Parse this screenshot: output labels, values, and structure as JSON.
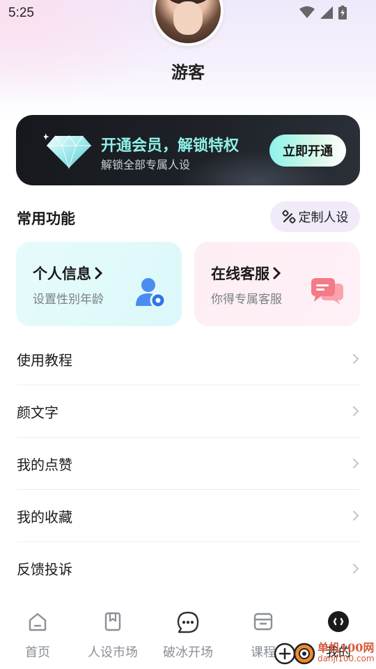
{
  "status_bar": {
    "time": "5:25"
  },
  "profile": {
    "username": "游客"
  },
  "vip": {
    "title": "开通会员，解锁特权",
    "subtitle": "解锁全部专属人设",
    "button_label": "立即开通"
  },
  "features": {
    "section_title": "常用功能",
    "custom_button_label": "定制人设",
    "cards": [
      {
        "title": "个人信息",
        "subtitle": "设置性别年龄",
        "icon": "user-settings-icon"
      },
      {
        "title": "在线客服",
        "subtitle": "你得专属客服",
        "icon": "chat-bubbles-icon"
      }
    ]
  },
  "menu": {
    "items": [
      {
        "label": "使用教程"
      },
      {
        "label": "颜文字"
      },
      {
        "label": "我的点赞"
      },
      {
        "label": "我的收藏"
      },
      {
        "label": "反馈投诉"
      }
    ]
  },
  "tab_bar": {
    "tabs": [
      {
        "label": "首页",
        "icon": "home-icon"
      },
      {
        "label": "人设市场",
        "icon": "bookmark-icon"
      },
      {
        "label": "破冰开场",
        "icon": "chat-dots-icon"
      },
      {
        "label": "课程",
        "icon": "archive-box-icon"
      },
      {
        "label": "我的",
        "icon": "face-icon"
      }
    ],
    "active_index": 4
  },
  "watermark": {
    "line1": "单机100网",
    "line2": "danji100.com"
  },
  "colors": {
    "vip_accent": "#8ff0e8",
    "vip_background": "#1a1d22",
    "info_card": "#e2faf9",
    "service_card": "#fdeff5",
    "icon_blue": "#4a8cf0",
    "icon_pink": "#f47a87"
  }
}
